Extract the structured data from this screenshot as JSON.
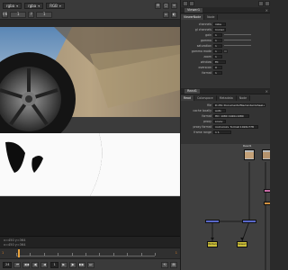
{
  "viewer": {
    "channels": "rgba",
    "layer": "rgba",
    "display_channel": "RGB",
    "toolbar2_label": "f/8",
    "gain_label": "1",
    "viewer_input": "Read1",
    "toolbar2_fields": [
      "f/8",
      "1",
      "Y",
      "1"
    ],
    "info_line1": "x=450 y=364",
    "info_line2": "x=450 y=364",
    "info_right1": "",
    "info_right2": ""
  },
  "timeline": {
    "range_start": "1",
    "range_end": "1",
    "frame": "1",
    "fps": "24"
  },
  "properties": {
    "panel_title": "Viewer1",
    "tabs": [
      "ViewerNode",
      "Node"
    ],
    "rows": [
      {
        "label": "channels",
        "value": "rgba"
      },
      {
        "label": "gl channels",
        "value": "(none)"
      },
      {
        "label": "gain",
        "value": "1"
      },
      {
        "label": "gamma",
        "value": "1"
      },
      {
        "label": "saturation",
        "value": "1"
      },
      {
        "label": "gamma mode",
        "value": "1"
      },
      {
        "label": "zoom",
        "value": "1"
      },
      {
        "label": "window",
        "value": "Fit"
      },
      {
        "label": "overscan",
        "value": "0"
      },
      {
        "label": "format",
        "value": "1"
      }
    ]
  },
  "read": {
    "panel_title": "Read1",
    "tabs": [
      "Read",
      "Colorspace",
      "Metadata",
      "Node"
    ],
    "rows": [
      {
        "label": "file",
        "value": "D:/My Documents/file/render/wheel.exr"
      },
      {
        "label": "cache locally",
        "value": "auto"
      },
      {
        "label": "format",
        "value": "HD_1080 1920x1080"
      },
      {
        "label": "proxy",
        "value": "proxy"
      },
      {
        "label": "proxy format",
        "value": "root.proxy_format 1024x778"
      },
      {
        "label": "frame range",
        "value": "1  1"
      }
    ]
  },
  "nodegraph": {
    "nodes": [
      {
        "label": "Read1"
      },
      {
        "label": "Read2"
      },
      {
        "label": "Merge1"
      },
      {
        "label": "Merge2"
      },
      {
        "label": "Write1"
      },
      {
        "label": "Viewer1"
      }
    ]
  },
  "colors": {
    "accent_orange": "#d57d2a",
    "node_blue": "#5968c9",
    "node_yellow": "#cdc03a",
    "node_pink": "#c66aa6"
  }
}
